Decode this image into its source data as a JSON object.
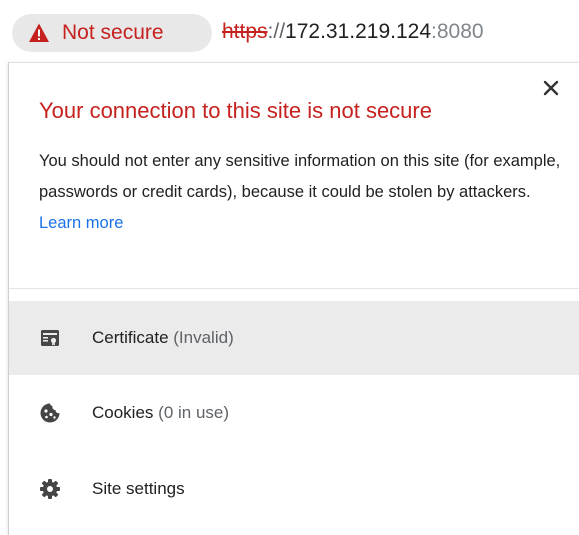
{
  "omnibox": {
    "security_label": "Not secure",
    "url_scheme": "https",
    "url_separator": "://",
    "url_host": "172.31.219.124",
    "url_port": ":8080"
  },
  "popup": {
    "title": "Your connection to this site is not secure",
    "description": "You should not enter any sensitive information on this site (for example, passwords or credit cards), because it could be stolen by attackers.",
    "learn_more": "Learn more",
    "items": [
      {
        "label": "Certificate",
        "sublabel": "(Invalid)",
        "icon": "certificate-icon"
      },
      {
        "label": "Cookies",
        "sublabel": "(0 in use)",
        "icon": "cookie-icon"
      },
      {
        "label": "Site settings",
        "sublabel": "",
        "icon": "gear-icon"
      }
    ]
  },
  "colors": {
    "danger": "#c5221f",
    "link": "#1a73e8",
    "chip_bg": "#e8e8e8",
    "hover_bg": "#ebebeb",
    "icon": "#454545"
  }
}
